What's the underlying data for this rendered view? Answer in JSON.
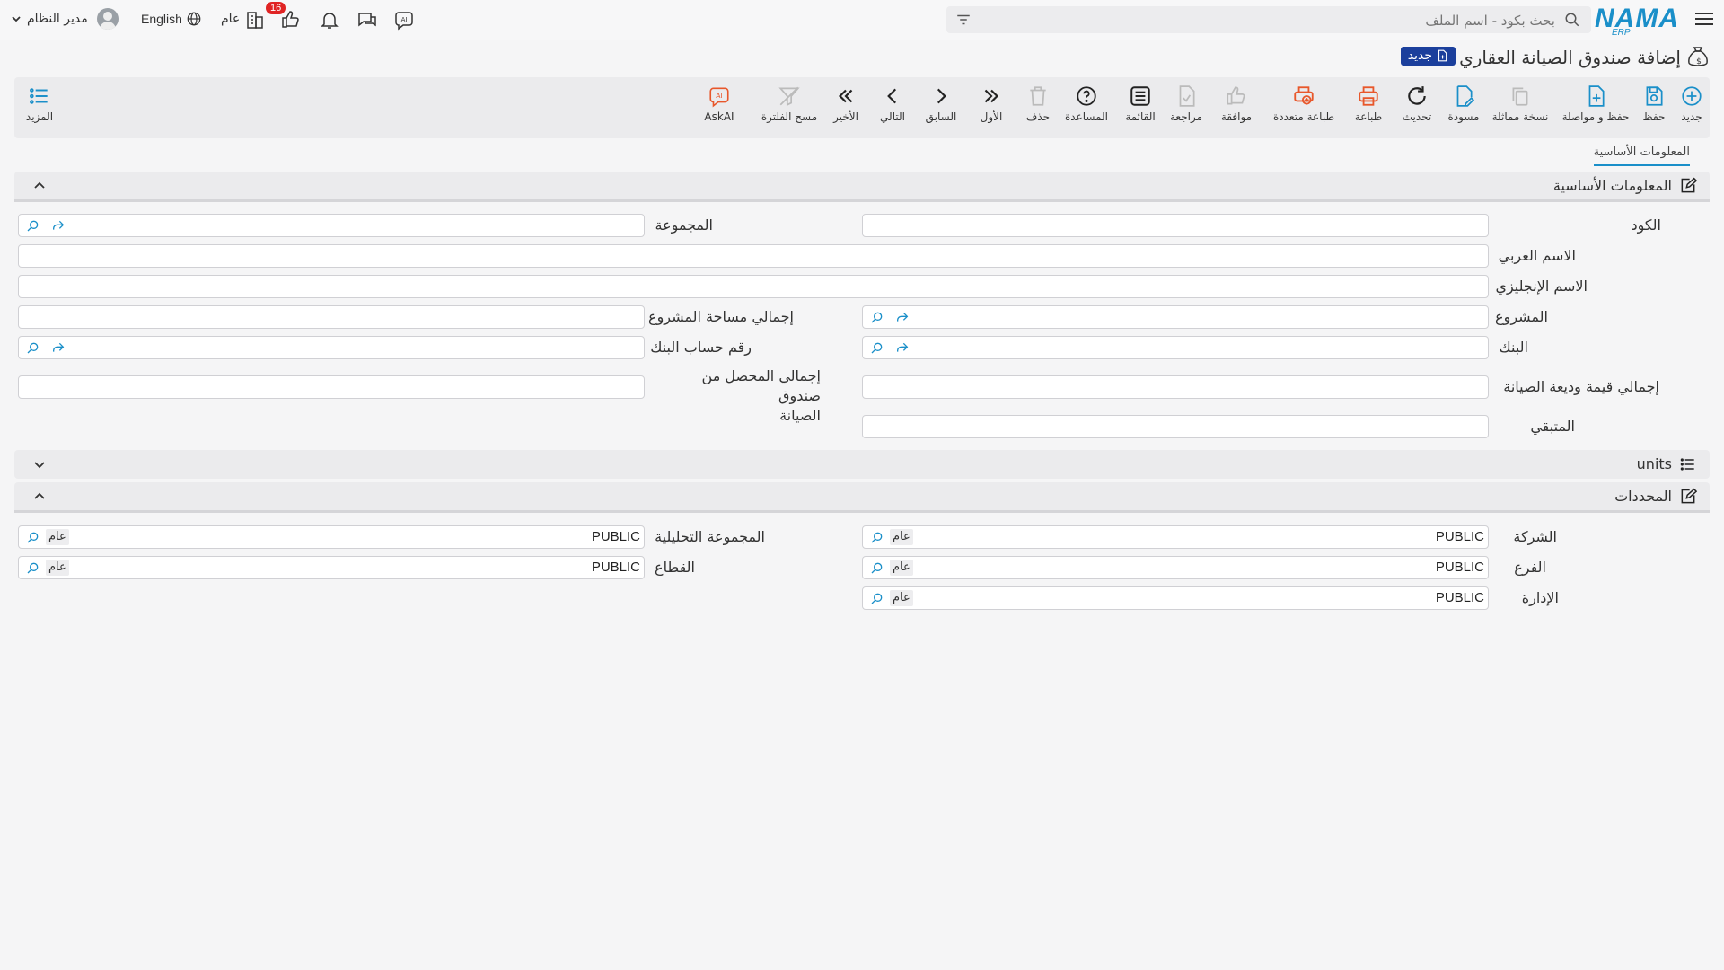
{
  "header": {
    "search_placeholder": "بحث بكود - اسم الملف",
    "logo_text": "NAMA",
    "logo_sub": "ERP",
    "notification_count": "16",
    "public_label": "عام",
    "language_label": "English",
    "user_name": "مدير النظام"
  },
  "page": {
    "title": "إضافة صندوق الصيانة العقاري",
    "new_badge": "جديد"
  },
  "toolbar": {
    "new": "جديد",
    "save": "حفظ",
    "save_continue": "حفظ و مواصلة",
    "duplicate": "نسخة مماثلة",
    "draft": "مسودة",
    "refresh": "تحديث",
    "print": "طباعة",
    "multi_print": "طباعة متعددة",
    "approve": "موافقة",
    "review": "مراجعة",
    "list": "القائمة",
    "help": "المساعدة",
    "delete": "حذف",
    "first": "الأول",
    "previous": "السابق",
    "next": "التالي",
    "last": "الأخير",
    "clear_filter": "مسح الفلترة",
    "ask_ai": "AskAI",
    "more": "المزيد"
  },
  "tabs": [
    "المعلومات الأساسية"
  ],
  "sections": {
    "basic_info": "المعلومات الأساسية",
    "units": "units",
    "dimensions": "المحددات"
  },
  "fields": {
    "code": "الكود",
    "group": "المجموعة",
    "arabic_name": "الاسم العربي",
    "english_name": "الاسم الإنجليزي",
    "project": "المشروع",
    "total_project_area": "إجمالي مساحة المشروع",
    "bank": "البنك",
    "bank_account_number": "رقم حساب البنك",
    "total_maintenance_deposit": "إجمالي قيمة وديعة الصيانة",
    "total_collected_line1": "إجمالي المحصل من صندوق",
    "total_collected_line2": "الصيانة",
    "remaining": "المتبقي"
  },
  "dimensions": {
    "company_label": "الشركة",
    "analytic_group_label": "المجموعة التحليلية",
    "branch_label": "الفرع",
    "sector_label": "القطاع",
    "department_label": "الإدارة",
    "value": "PUBLIC",
    "tag": "عام"
  }
}
